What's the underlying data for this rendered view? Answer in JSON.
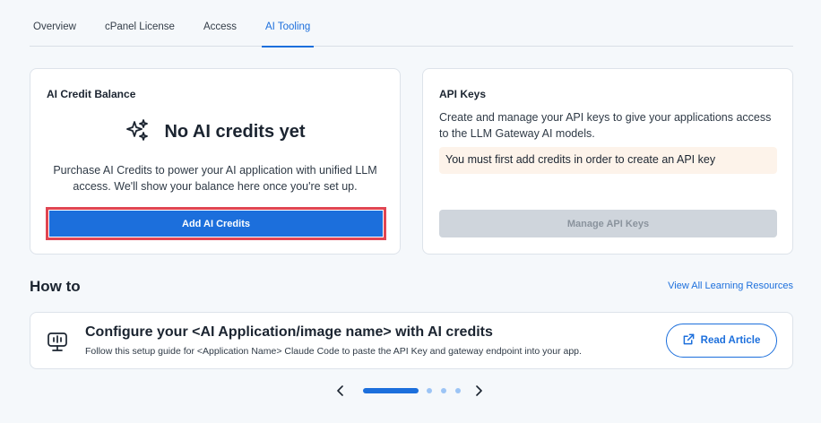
{
  "tabs": [
    {
      "label": "Overview"
    },
    {
      "label": "cPanel License"
    },
    {
      "label": "Access"
    },
    {
      "label": "AI Tooling"
    }
  ],
  "credit_card": {
    "title": "AI Credit Balance",
    "empty_title": "No AI credits yet",
    "description": "Purchase AI Credits to power your AI application with unified LLM access. We'll show your balance here once you're set up.",
    "button_label": "Add AI Credits",
    "icon": "sparkles-icon"
  },
  "api_card": {
    "title": "API Keys",
    "description": "Create and manage your API keys to give your applications access to the LLM Gateway AI models.",
    "warning": "You must first add credits in order to create an API key",
    "button_label": "Manage API Keys"
  },
  "howto": {
    "title": "How to",
    "view_all": "View All Learning Resources",
    "article": {
      "title": "Configure your <AI Application/image name> with AI credits",
      "description": "Follow this setup guide for <Application Name> Claude Code to paste the API Key and gateway endpoint into your app.",
      "button_label": "Read Article",
      "icon": "computer-icon"
    }
  },
  "colors": {
    "accent": "#1c6fdc",
    "highlight_border": "#e04552",
    "warning_bg": "#fdf3ea",
    "disabled_bg": "#cfd5dc"
  }
}
